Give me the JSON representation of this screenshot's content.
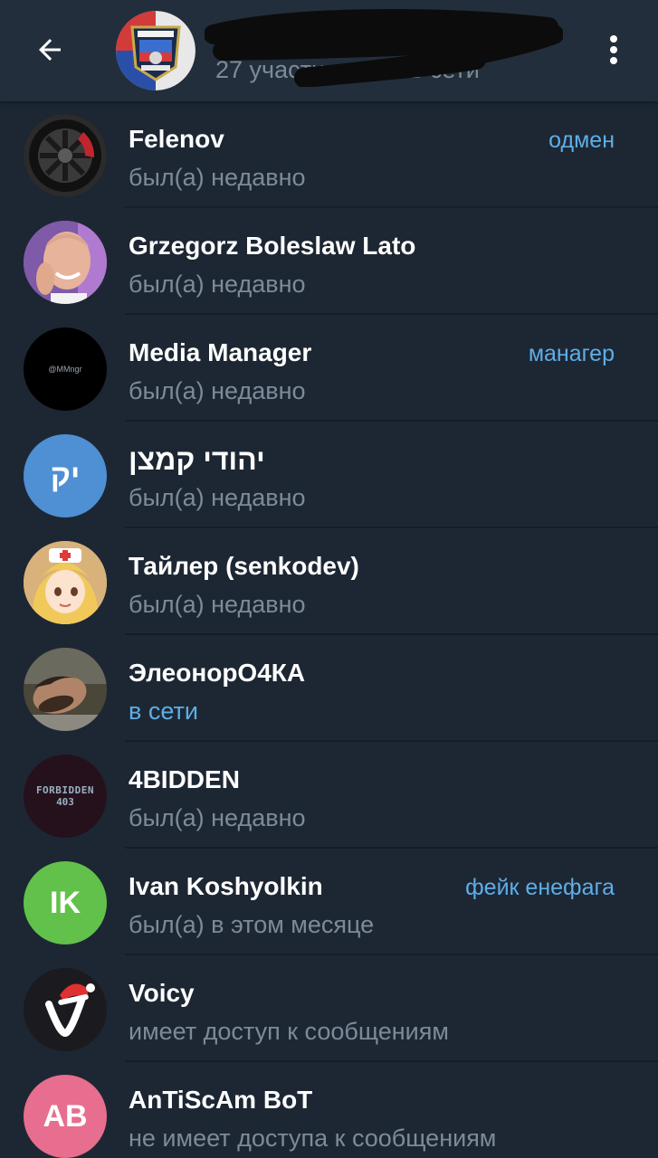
{
  "header": {
    "subtitle": "27 участников, 4 в сети",
    "back_icon": "arrow-left-icon",
    "menu_icon": "more-vertical-icon"
  },
  "members": [
    {
      "name": "Felenov",
      "status": "был(а) недавно",
      "role": "одмен",
      "avatar": "car-wheel-photo"
    },
    {
      "name": "Grzegorz Boleslaw Lato",
      "status": "был(а) недавно",
      "role": "",
      "avatar": "person-photo"
    },
    {
      "name": "Media Manager",
      "status": "был(а) недавно",
      "role": "манагер",
      "avatar": "mmngr-logo",
      "avatar_text": "@MMngr"
    },
    {
      "name": "יהודי קמצן",
      "status": "был(а) недавно",
      "role": "",
      "avatar": "initials",
      "initials": "יק"
    },
    {
      "name": "Тайлер (senkodev)",
      "status": "был(а) недавно",
      "role": "",
      "avatar": "anime-photo"
    },
    {
      "name": "ЭлеонорО4КА",
      "status": "в сети",
      "role": "",
      "avatar": "person-lying-photo"
    },
    {
      "name": "4BIDDEN",
      "status": "был(а) недавно",
      "role": "",
      "avatar": "forbidden-logo",
      "avatar_text": "FORBIDDEN",
      "avatar_subtext": "403"
    },
    {
      "name": "Ivan Koshyolkin",
      "status": "был(а) в этом месяце",
      "role": "фейк енефага",
      "avatar": "initials",
      "initials": "IK"
    },
    {
      "name": "Voicy",
      "status": "имеет доступ к сообщениям",
      "role": "",
      "avatar": "voicy-logo"
    },
    {
      "name": "AnTiScAm BoT",
      "status": "не имеет доступа к сообщениям",
      "role": "",
      "avatar": "initials",
      "initials": "AB"
    }
  ],
  "colors": {
    "background": "#1d2733",
    "header": "#222e3b",
    "accent": "#5eaee8",
    "muted": "#7d8b99",
    "avatar_blue": "#4f8fd4",
    "avatar_green": "#62c14a",
    "avatar_pink": "#e76e8e"
  }
}
